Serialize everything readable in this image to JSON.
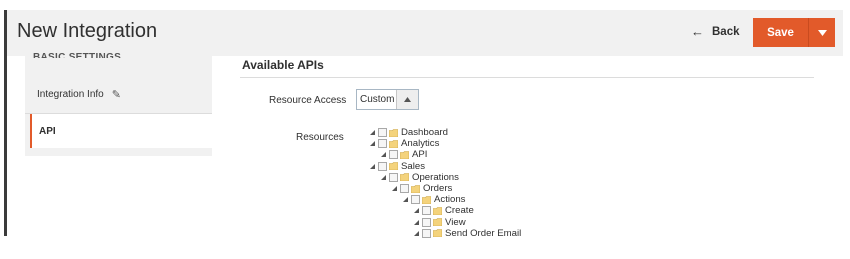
{
  "header": {
    "title": "New Integration",
    "back_label": "Back",
    "back_icon": "arrow-left-icon",
    "save_label": "Save",
    "save_split_icon": "chevron-down-icon",
    "accent_color": "#e25a2a"
  },
  "sidebar": {
    "ghost_heading": "BASIC SETTINGS",
    "items": [
      {
        "label": "Integration Info",
        "icon": "pencil-icon"
      },
      {
        "label": "API",
        "active": true
      }
    ]
  },
  "main": {
    "section_title": "Available APIs",
    "resource_access": {
      "label": "Resource Access",
      "value": "Custom"
    },
    "resources": {
      "label": "Resources",
      "tree": [
        {
          "label": "Dashboard",
          "level": 0
        },
        {
          "label": "Analytics",
          "level": 0
        },
        {
          "label": "API",
          "level": 1
        },
        {
          "label": "Sales",
          "level": 0
        },
        {
          "label": "Operations",
          "level": 1
        },
        {
          "label": "Orders",
          "level": 2
        },
        {
          "label": "Actions",
          "level": 3
        },
        {
          "label": "Create",
          "level": 4
        },
        {
          "label": "View",
          "level": 4
        },
        {
          "label": "Send Order Email",
          "level": 4
        }
      ]
    }
  }
}
